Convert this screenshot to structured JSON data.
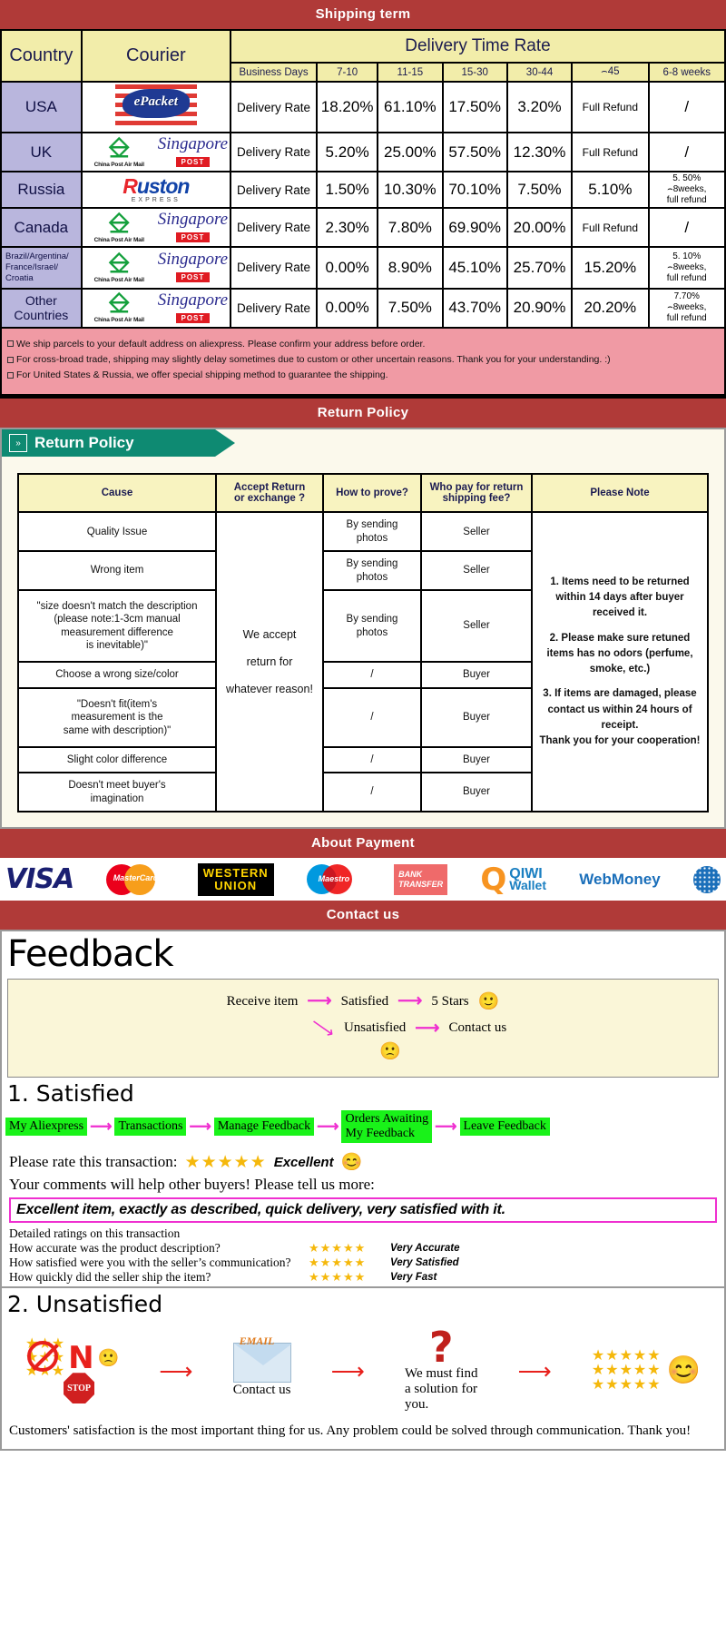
{
  "banners": {
    "shipping": "Shipping term",
    "return": "Return Policy",
    "payment": "About Payment",
    "contact": "Contact us"
  },
  "shipping_table": {
    "headers": {
      "country": "Country",
      "courier": "Courier",
      "delivery_time_rate": "Delivery Time Rate",
      "business_days": "Business Days",
      "ranges": [
        "7-10",
        "11-15",
        "15-30",
        "30-44",
        "⌢45",
        "6-8 weeks"
      ]
    },
    "rows": [
      {
        "country": "USA",
        "couriers": [
          "epacket"
        ],
        "label": "Delivery Rate",
        "values": [
          "18.20%",
          "61.10%",
          "17.50%",
          "3.20%",
          "Full Refund",
          "/"
        ]
      },
      {
        "country": "UK",
        "couriers": [
          "china-post-air-mail",
          "singapore-post"
        ],
        "label": "Delivery Rate",
        "values": [
          "5.20%",
          "25.00%",
          "57.50%",
          "12.30%",
          "Full Refund",
          "/"
        ]
      },
      {
        "country": "Russia",
        "couriers": [
          "ruston-express"
        ],
        "label": "Delivery Rate",
        "values": [
          "1.50%",
          "10.30%",
          "70.10%",
          "7.50%",
          "5.10%",
          "5. 50%\n⌢8weeks,\nfull refund"
        ]
      },
      {
        "country": "Canada",
        "couriers": [
          "china-post-air-mail",
          "singapore-post"
        ],
        "label": "Delivery Rate",
        "values": [
          "2.30%",
          "7.80%",
          "69.90%",
          "20.00%",
          "Full Refund",
          "/"
        ]
      },
      {
        "country": "Brazil/Argentina/\nFrance/Israel/\nCroatia",
        "couriers": [
          "china-post-air-mail",
          "singapore-post"
        ],
        "label": "Delivery Rate",
        "values": [
          "0.00%",
          "8.90%",
          "45.10%",
          "25.70%",
          "15.20%",
          "5. 10%\n⌢8weeks,\nfull refund"
        ]
      },
      {
        "country": "Other Countries",
        "couriers": [
          "china-post-air-mail",
          "singapore-post"
        ],
        "label": "Delivery Rate",
        "values": [
          "0.00%",
          "7.50%",
          "43.70%",
          "20.90%",
          "20.20%",
          "7.70%\n⌢8weeks,\nfull refund"
        ]
      }
    ],
    "notes": [
      "We ship parcels to your default address on aliexpress. Please confirm your address before order.",
      "For cross-broad trade, shipping may slightly delay sometimes due to custom or other uncertain reasons. Thank you for your understanding. :)",
      "For United States & Russia, we offer special shipping method to guarantee the shipping."
    ]
  },
  "courier_logos": {
    "epacket": "ePacket",
    "china_post": "China Post Air Mail",
    "singapore_post_word": "Singapore",
    "singapore_post_tag": "POST",
    "ruston_k": "R",
    "ruston_rest": "uston",
    "ruston_sub": "EXPRESS"
  },
  "return_policy": {
    "tab_label": "Return Policy",
    "headers": [
      "Cause",
      "Accept Return\nor exchange ?",
      "How to prove?",
      "Who pay for return\nshipping fee?",
      "Please Note"
    ],
    "accept_text": "We accept\nreturn for\nwhatever reason!",
    "rows": [
      {
        "cause": "Quality Issue",
        "prove": "By sending\nphotos",
        "payer": "Seller"
      },
      {
        "cause": "Wrong item",
        "prove": "By sending\nphotos",
        "payer": "Seller"
      },
      {
        "cause": "\"size doesn't match the description\n(please note:1-3cm manual\nmeasurement difference\nis inevitable)\"",
        "prove": "By sending\nphotos",
        "payer": "Seller"
      },
      {
        "cause": "Choose a wrong size/color",
        "prove": "/",
        "payer": "Buyer"
      },
      {
        "cause": "\"Doesn't fit(item's\nmeasurement is the\nsame with description)\"",
        "prove": "/",
        "payer": "Buyer"
      },
      {
        "cause": "Slight color difference",
        "prove": "/",
        "payer": "Buyer"
      },
      {
        "cause": "Doesn't meet buyer's\nimagination",
        "prove": "/",
        "payer": "Buyer"
      }
    ],
    "notes": [
      "1. Items need to be returned within 14 days after buyer received it.",
      "2. Please make sure retuned items has no odors (perfume, smoke, etc.)",
      "3. If items are damaged, please contact us within 24 hours of receipt.\nThank you for your cooperation!"
    ]
  },
  "payment_methods": [
    {
      "name": "visa",
      "label": "VISA"
    },
    {
      "name": "mastercard",
      "label": "MasterCard"
    },
    {
      "name": "western-union",
      "label1": "WESTERN",
      "label2": "UNION"
    },
    {
      "name": "maestro",
      "label": "Maestro"
    },
    {
      "name": "bank-transfer",
      "label1": "BANK",
      "label2": "TRANSFER"
    },
    {
      "name": "qiwi-wallet",
      "label1": "QIWI",
      "label2": "Wallet"
    },
    {
      "name": "webmoney",
      "label": "WebMoney"
    }
  ],
  "feedback": {
    "title": "Feedback",
    "flow": {
      "receive": "Receive item",
      "satisfied": "Satisfied",
      "five_stars": "5 Stars",
      "unsatisfied": "Unsatisfied",
      "contact": "Contact us"
    },
    "satisfied": {
      "heading": "1. Satisfied",
      "steps": [
        "My Aliexpress",
        "Transactions",
        "Manage Feedback",
        "Orders Awaiting\nMy Feedback",
        "Leave Feedback"
      ],
      "rate_label": "Please rate this transaction:",
      "stars": "★★★★★",
      "rate_word": "Excellent",
      "comment_prompt": "Your comments will help other buyers! Please tell us more:",
      "comment": "Excellent item, exactly as described, quick delivery, very satisfied with it.",
      "detailed_heading": "Detailed ratings on this transaction",
      "detailed": [
        {
          "question": "How accurate was the product description?",
          "stars": "★★★★★",
          "value": "Very Accurate"
        },
        {
          "question": "How satisfied were you with the seller’s communication?",
          "stars": "★★★★★",
          "value": "Very Satisfied"
        },
        {
          "question": "How quickly did the seller ship the item?",
          "stars": "★★★★★",
          "value": "Very Fast"
        }
      ]
    },
    "unsatisfied": {
      "heading": "2. Unsatisfied",
      "no_label": "N",
      "stop_label": "STOP",
      "email_label": "EMAIL",
      "contact_caption": "Contact us",
      "solution_caption": "We must find\na solution for\nyou.",
      "question_mark": "?",
      "closing": "Customers' satisfaction is the most important thing for us. Any problem could be solved through communication. Thank you!"
    }
  }
}
